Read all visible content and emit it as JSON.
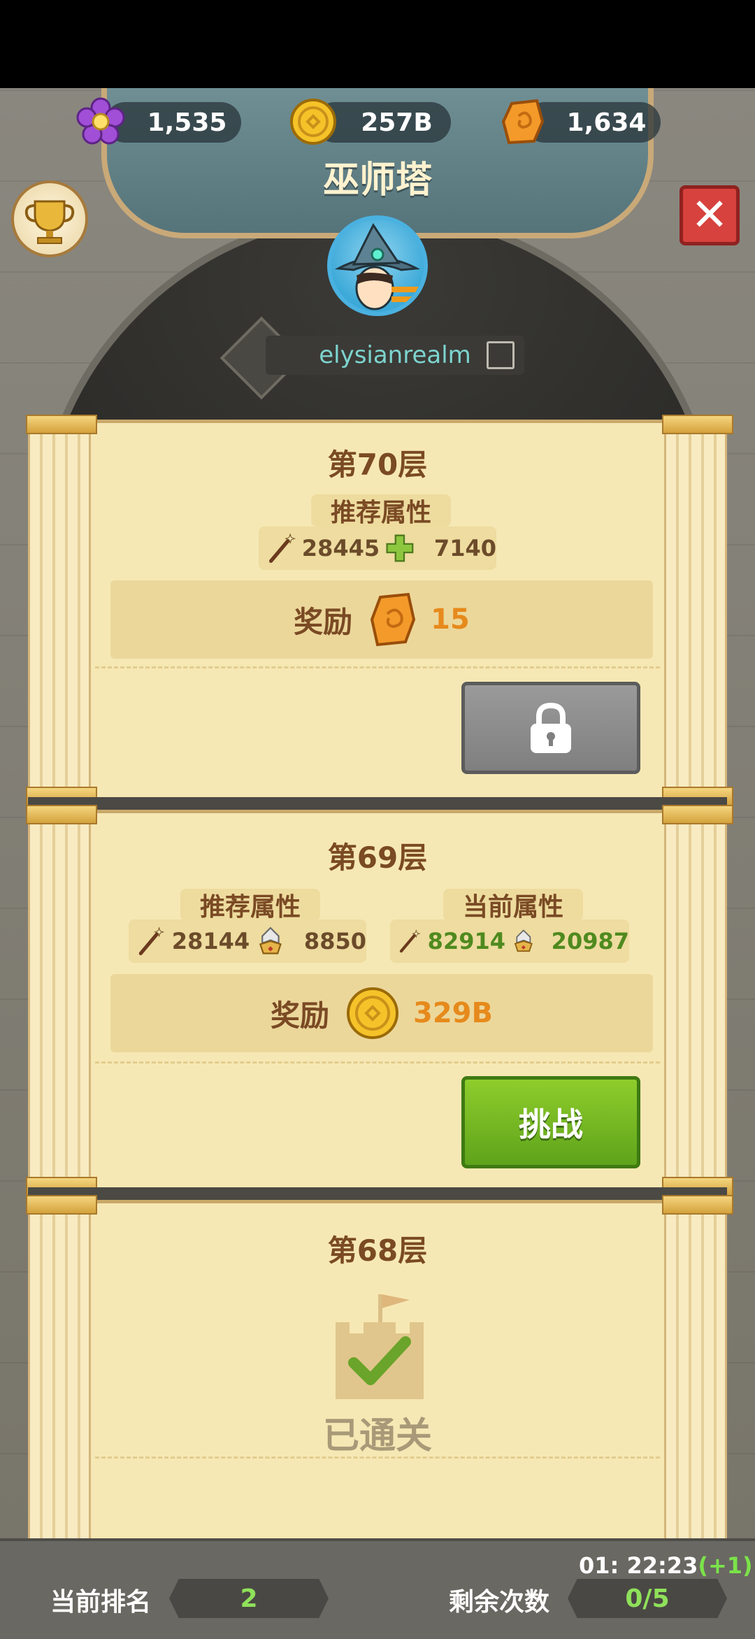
{
  "currencies": {
    "gems": "1,535",
    "gold": "257B",
    "amber": "1,634"
  },
  "header": {
    "title": "巫师塔",
    "player_name": "elysianrealm"
  },
  "floors": {
    "f70": {
      "name": "第70层",
      "recommended_label": "推荐属性",
      "rec_attack": "28445",
      "rec_hp": "7140",
      "reward_label": "奖励",
      "reward_value": "15"
    },
    "f69": {
      "name": "第69层",
      "recommended_label": "推荐属性",
      "rec_attack": "28144",
      "rec_defense": "8850",
      "current_label": "当前属性",
      "cur_attack": "82914",
      "cur_defense": "20987",
      "reward_label": "奖励",
      "reward_value": "329B",
      "challenge_label": "挑战"
    },
    "f68": {
      "name": "第68层",
      "cleared_label": "已通关"
    }
  },
  "footer": {
    "rank_label": "当前排名",
    "rank_value": "2",
    "attempts_label": "剩余次数",
    "attempts_value": "0/5",
    "timer": "01: 22:23",
    "timer_bonus": "(+1)"
  },
  "colors": {
    "green_button": "#6fb51f",
    "reward_orange": "#e68a1c",
    "panel": "#f6e8b4"
  }
}
